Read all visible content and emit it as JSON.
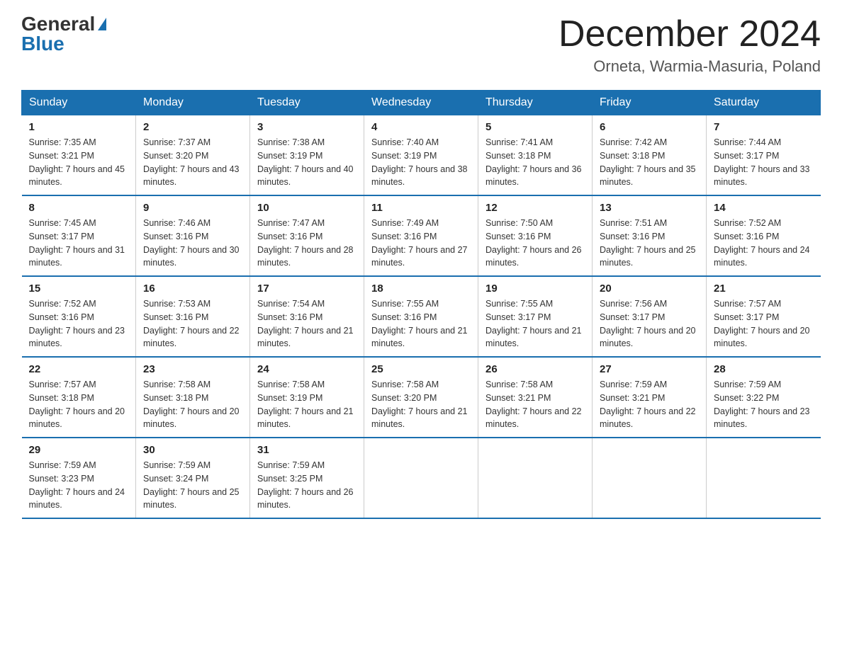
{
  "header": {
    "logo_general": "General",
    "logo_blue": "Blue",
    "month_title": "December 2024",
    "location": "Orneta, Warmia-Masuria, Poland"
  },
  "days_of_week": [
    "Sunday",
    "Monday",
    "Tuesday",
    "Wednesday",
    "Thursday",
    "Friday",
    "Saturday"
  ],
  "weeks": [
    [
      {
        "day": "1",
        "sunrise": "7:35 AM",
        "sunset": "3:21 PM",
        "daylight": "7 hours and 45 minutes."
      },
      {
        "day": "2",
        "sunrise": "7:37 AM",
        "sunset": "3:20 PM",
        "daylight": "7 hours and 43 minutes."
      },
      {
        "day": "3",
        "sunrise": "7:38 AM",
        "sunset": "3:19 PM",
        "daylight": "7 hours and 40 minutes."
      },
      {
        "day": "4",
        "sunrise": "7:40 AM",
        "sunset": "3:19 PM",
        "daylight": "7 hours and 38 minutes."
      },
      {
        "day": "5",
        "sunrise": "7:41 AM",
        "sunset": "3:18 PM",
        "daylight": "7 hours and 36 minutes."
      },
      {
        "day": "6",
        "sunrise": "7:42 AM",
        "sunset": "3:18 PM",
        "daylight": "7 hours and 35 minutes."
      },
      {
        "day": "7",
        "sunrise": "7:44 AM",
        "sunset": "3:17 PM",
        "daylight": "7 hours and 33 minutes."
      }
    ],
    [
      {
        "day": "8",
        "sunrise": "7:45 AM",
        "sunset": "3:17 PM",
        "daylight": "7 hours and 31 minutes."
      },
      {
        "day": "9",
        "sunrise": "7:46 AM",
        "sunset": "3:16 PM",
        "daylight": "7 hours and 30 minutes."
      },
      {
        "day": "10",
        "sunrise": "7:47 AM",
        "sunset": "3:16 PM",
        "daylight": "7 hours and 28 minutes."
      },
      {
        "day": "11",
        "sunrise": "7:49 AM",
        "sunset": "3:16 PM",
        "daylight": "7 hours and 27 minutes."
      },
      {
        "day": "12",
        "sunrise": "7:50 AM",
        "sunset": "3:16 PM",
        "daylight": "7 hours and 26 minutes."
      },
      {
        "day": "13",
        "sunrise": "7:51 AM",
        "sunset": "3:16 PM",
        "daylight": "7 hours and 25 minutes."
      },
      {
        "day": "14",
        "sunrise": "7:52 AM",
        "sunset": "3:16 PM",
        "daylight": "7 hours and 24 minutes."
      }
    ],
    [
      {
        "day": "15",
        "sunrise": "7:52 AM",
        "sunset": "3:16 PM",
        "daylight": "7 hours and 23 minutes."
      },
      {
        "day": "16",
        "sunrise": "7:53 AM",
        "sunset": "3:16 PM",
        "daylight": "7 hours and 22 minutes."
      },
      {
        "day": "17",
        "sunrise": "7:54 AM",
        "sunset": "3:16 PM",
        "daylight": "7 hours and 21 minutes."
      },
      {
        "day": "18",
        "sunrise": "7:55 AM",
        "sunset": "3:16 PM",
        "daylight": "7 hours and 21 minutes."
      },
      {
        "day": "19",
        "sunrise": "7:55 AM",
        "sunset": "3:17 PM",
        "daylight": "7 hours and 21 minutes."
      },
      {
        "day": "20",
        "sunrise": "7:56 AM",
        "sunset": "3:17 PM",
        "daylight": "7 hours and 20 minutes."
      },
      {
        "day": "21",
        "sunrise": "7:57 AM",
        "sunset": "3:17 PM",
        "daylight": "7 hours and 20 minutes."
      }
    ],
    [
      {
        "day": "22",
        "sunrise": "7:57 AM",
        "sunset": "3:18 PM",
        "daylight": "7 hours and 20 minutes."
      },
      {
        "day": "23",
        "sunrise": "7:58 AM",
        "sunset": "3:18 PM",
        "daylight": "7 hours and 20 minutes."
      },
      {
        "day": "24",
        "sunrise": "7:58 AM",
        "sunset": "3:19 PM",
        "daylight": "7 hours and 21 minutes."
      },
      {
        "day": "25",
        "sunrise": "7:58 AM",
        "sunset": "3:20 PM",
        "daylight": "7 hours and 21 minutes."
      },
      {
        "day": "26",
        "sunrise": "7:58 AM",
        "sunset": "3:21 PM",
        "daylight": "7 hours and 22 minutes."
      },
      {
        "day": "27",
        "sunrise": "7:59 AM",
        "sunset": "3:21 PM",
        "daylight": "7 hours and 22 minutes."
      },
      {
        "day": "28",
        "sunrise": "7:59 AM",
        "sunset": "3:22 PM",
        "daylight": "7 hours and 23 minutes."
      }
    ],
    [
      {
        "day": "29",
        "sunrise": "7:59 AM",
        "sunset": "3:23 PM",
        "daylight": "7 hours and 24 minutes."
      },
      {
        "day": "30",
        "sunrise": "7:59 AM",
        "sunset": "3:24 PM",
        "daylight": "7 hours and 25 minutes."
      },
      {
        "day": "31",
        "sunrise": "7:59 AM",
        "sunset": "3:25 PM",
        "daylight": "7 hours and 26 minutes."
      },
      null,
      null,
      null,
      null
    ]
  ]
}
